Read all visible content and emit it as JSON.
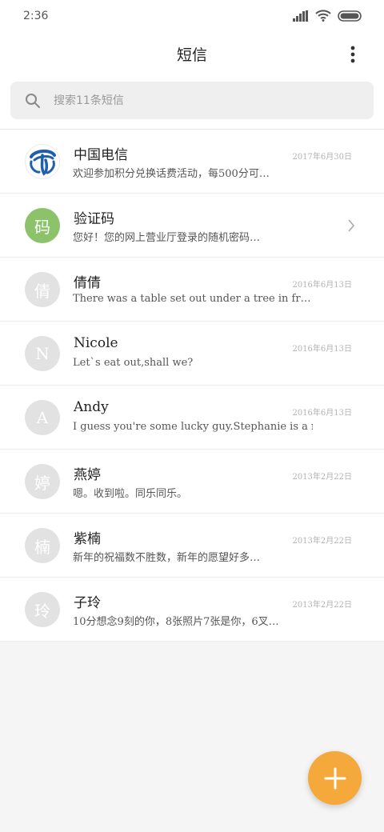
{
  "status_bar": {
    "time": "2:36"
  },
  "header": {
    "title": "短信"
  },
  "search": {
    "placeholder": "搜索11条短信"
  },
  "colors": {
    "accent": "#f6a93b",
    "verification_avatar": "#8cc26a"
  },
  "conversations": [
    {
      "name": "中国电信",
      "preview": "欢迎参加积分兑换话费活动，每500分可…",
      "date": "2017年6月30日",
      "avatar": "",
      "avatar_icon": "china-telecom-logo"
    },
    {
      "name": "验证码",
      "preview": "您好！您的网上营业厅登录的随机密码…",
      "date": "",
      "avatar": "码",
      "avatar_icon": ""
    },
    {
      "name": "倩倩",
      "preview": "There was a table set out under a tree in fr…",
      "date": "2016年6月13日",
      "avatar": "倩",
      "avatar_icon": ""
    },
    {
      "name": "Nicole",
      "preview": "Let`s eat out,shall we?",
      "date": "2016年6月13日",
      "avatar": "N",
      "avatar_icon": ""
    },
    {
      "name": "Andy",
      "preview": "I guess you're some lucky guy.Stephanie is a ni…",
      "date": "2016年6月13日",
      "avatar": "A",
      "avatar_icon": ""
    },
    {
      "name": "燕婷",
      "preview": "嗯。收到啦。同乐同乐。",
      "date": "2013年2月22日",
      "avatar": "婷",
      "avatar_icon": ""
    },
    {
      "name": "紫楠",
      "preview": "新年的祝福数不胜数，新年的愿望好多…",
      "date": "2013年2月22日",
      "avatar": "楠",
      "avatar_icon": ""
    },
    {
      "name": "子玲",
      "preview": "10分想念9刻的你，8张照片7张是你，6叉…",
      "date": "2013年2月22日",
      "avatar": "玲",
      "avatar_icon": ""
    }
  ]
}
